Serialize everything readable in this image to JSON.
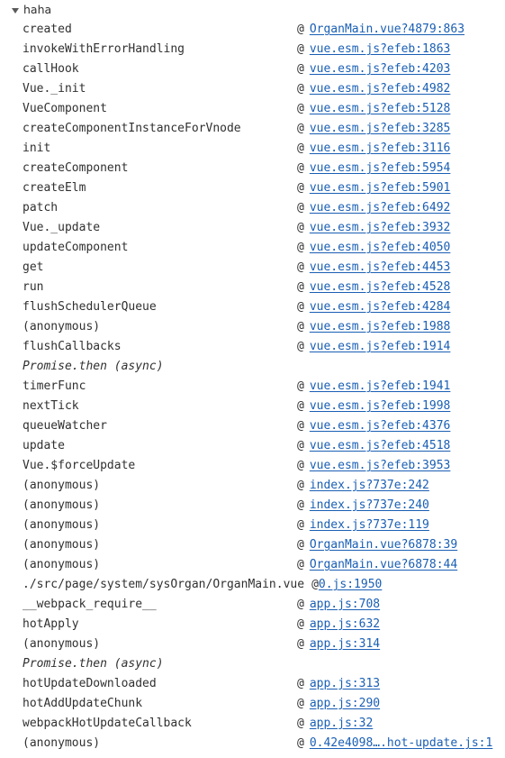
{
  "group": {
    "label": "haha",
    "expanded": true,
    "disclosure_icon": "triangle-down-icon"
  },
  "colors": {
    "text": "#303030",
    "link": "#1a5fb4",
    "background": "#ffffff",
    "disclosure": "#5a5a5a"
  },
  "at_separator": "@",
  "frames": [
    {
      "fn": "created",
      "link": "OrganMain.vue?4879:863",
      "async": false,
      "wide": false
    },
    {
      "fn": "invokeWithErrorHandling",
      "link": "vue.esm.js?efeb:1863",
      "async": false,
      "wide": false
    },
    {
      "fn": "callHook",
      "link": "vue.esm.js?efeb:4203",
      "async": false,
      "wide": false
    },
    {
      "fn": "Vue._init",
      "link": "vue.esm.js?efeb:4982",
      "async": false,
      "wide": false
    },
    {
      "fn": "VueComponent",
      "link": "vue.esm.js?efeb:5128",
      "async": false,
      "wide": false
    },
    {
      "fn": "createComponentInstanceForVnode",
      "link": "vue.esm.js?efeb:3285",
      "async": false,
      "wide": false
    },
    {
      "fn": "init",
      "link": "vue.esm.js?efeb:3116",
      "async": false,
      "wide": false
    },
    {
      "fn": "createComponent",
      "link": "vue.esm.js?efeb:5954",
      "async": false,
      "wide": false
    },
    {
      "fn": "createElm",
      "link": "vue.esm.js?efeb:5901",
      "async": false,
      "wide": false
    },
    {
      "fn": "patch",
      "link": "vue.esm.js?efeb:6492",
      "async": false,
      "wide": false
    },
    {
      "fn": "Vue._update",
      "link": "vue.esm.js?efeb:3932",
      "async": false,
      "wide": false
    },
    {
      "fn": "updateComponent",
      "link": "vue.esm.js?efeb:4050",
      "async": false,
      "wide": false
    },
    {
      "fn": "get",
      "link": "vue.esm.js?efeb:4453",
      "async": false,
      "wide": false
    },
    {
      "fn": "run",
      "link": "vue.esm.js?efeb:4528",
      "async": false,
      "wide": false
    },
    {
      "fn": "flushSchedulerQueue",
      "link": "vue.esm.js?efeb:4284",
      "async": false,
      "wide": false
    },
    {
      "fn": "(anonymous)",
      "link": "vue.esm.js?efeb:1988",
      "async": false,
      "wide": false
    },
    {
      "fn": "flushCallbacks",
      "link": "vue.esm.js?efeb:1914",
      "async": false,
      "wide": false
    },
    {
      "fn": "Promise.then (async)",
      "link": "",
      "async": true,
      "wide": false
    },
    {
      "fn": "timerFunc",
      "link": "vue.esm.js?efeb:1941",
      "async": false,
      "wide": false
    },
    {
      "fn": "nextTick",
      "link": "vue.esm.js?efeb:1998",
      "async": false,
      "wide": false
    },
    {
      "fn": "queueWatcher",
      "link": "vue.esm.js?efeb:4376",
      "async": false,
      "wide": false
    },
    {
      "fn": "update",
      "link": "vue.esm.js?efeb:4518",
      "async": false,
      "wide": false
    },
    {
      "fn": "Vue.$forceUpdate",
      "link": "vue.esm.js?efeb:3953",
      "async": false,
      "wide": false
    },
    {
      "fn": "(anonymous)",
      "link": "index.js?737e:242",
      "async": false,
      "wide": false
    },
    {
      "fn": "(anonymous)",
      "link": "index.js?737e:240",
      "async": false,
      "wide": false
    },
    {
      "fn": "(anonymous)",
      "link": "index.js?737e:119",
      "async": false,
      "wide": false
    },
    {
      "fn": "(anonymous)",
      "link": "OrganMain.vue?6878:39",
      "async": false,
      "wide": false
    },
    {
      "fn": "(anonymous)",
      "link": "OrganMain.vue?6878:44",
      "async": false,
      "wide": false
    },
    {
      "fn": "./src/page/system/sysOrgan/OrganMain.vue",
      "link": "0.js:1950",
      "async": false,
      "wide": true
    },
    {
      "fn": "__webpack_require__",
      "link": "app.js:708",
      "async": false,
      "wide": false
    },
    {
      "fn": "hotApply",
      "link": "app.js:632",
      "async": false,
      "wide": false
    },
    {
      "fn": "(anonymous)",
      "link": "app.js:314",
      "async": false,
      "wide": false
    },
    {
      "fn": "Promise.then (async)",
      "link": "",
      "async": true,
      "wide": false
    },
    {
      "fn": "hotUpdateDownloaded",
      "link": "app.js:313",
      "async": false,
      "wide": false
    },
    {
      "fn": "hotAddUpdateChunk",
      "link": "app.js:290",
      "async": false,
      "wide": false
    },
    {
      "fn": "webpackHotUpdateCallback",
      "link": "app.js:32",
      "async": false,
      "wide": false
    },
    {
      "fn": "(anonymous)",
      "link": "0.42e4098….hot-update.js:1",
      "async": false,
      "wide": false
    }
  ]
}
